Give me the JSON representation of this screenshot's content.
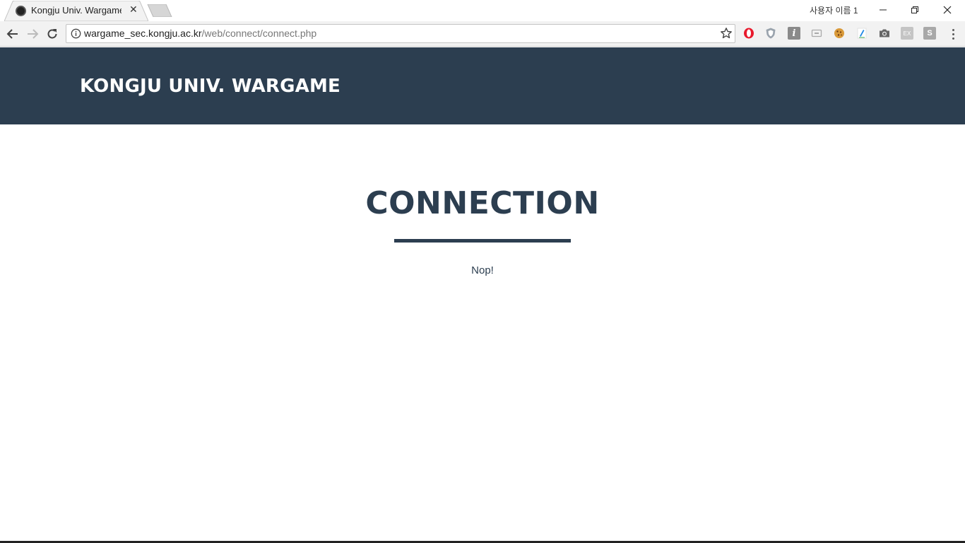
{
  "browser": {
    "tab": {
      "title": "Kongju Univ. Wargame",
      "close_glyph": "✕",
      "favicon": "site-favicon"
    },
    "profile_name": "사용자 이름 1",
    "url": {
      "host": "wargame_sec.kongju.ac.kr",
      "path": "/web/connect/connect.php"
    },
    "window_controls": [
      "minimize-icon",
      "restore-icon",
      "close-icon"
    ],
    "extensions": [
      "opera-icon",
      "shield-icon",
      "info-icon",
      "cast-icon",
      "cookie-icon",
      "pen-icon",
      "camera-icon",
      "ex-icon",
      "s-icon"
    ],
    "ext_labels": {
      "info": "i",
      "ex": "EX",
      "s": "S"
    }
  },
  "site": {
    "brand": "KONGJU UNIV. WARGAME",
    "section_title": "CONNECTION",
    "message": "Nop!"
  },
  "colors": {
    "header_bg": "#2c3e50",
    "heading": "#2c3e50",
    "page_bg": "#ffffff"
  }
}
